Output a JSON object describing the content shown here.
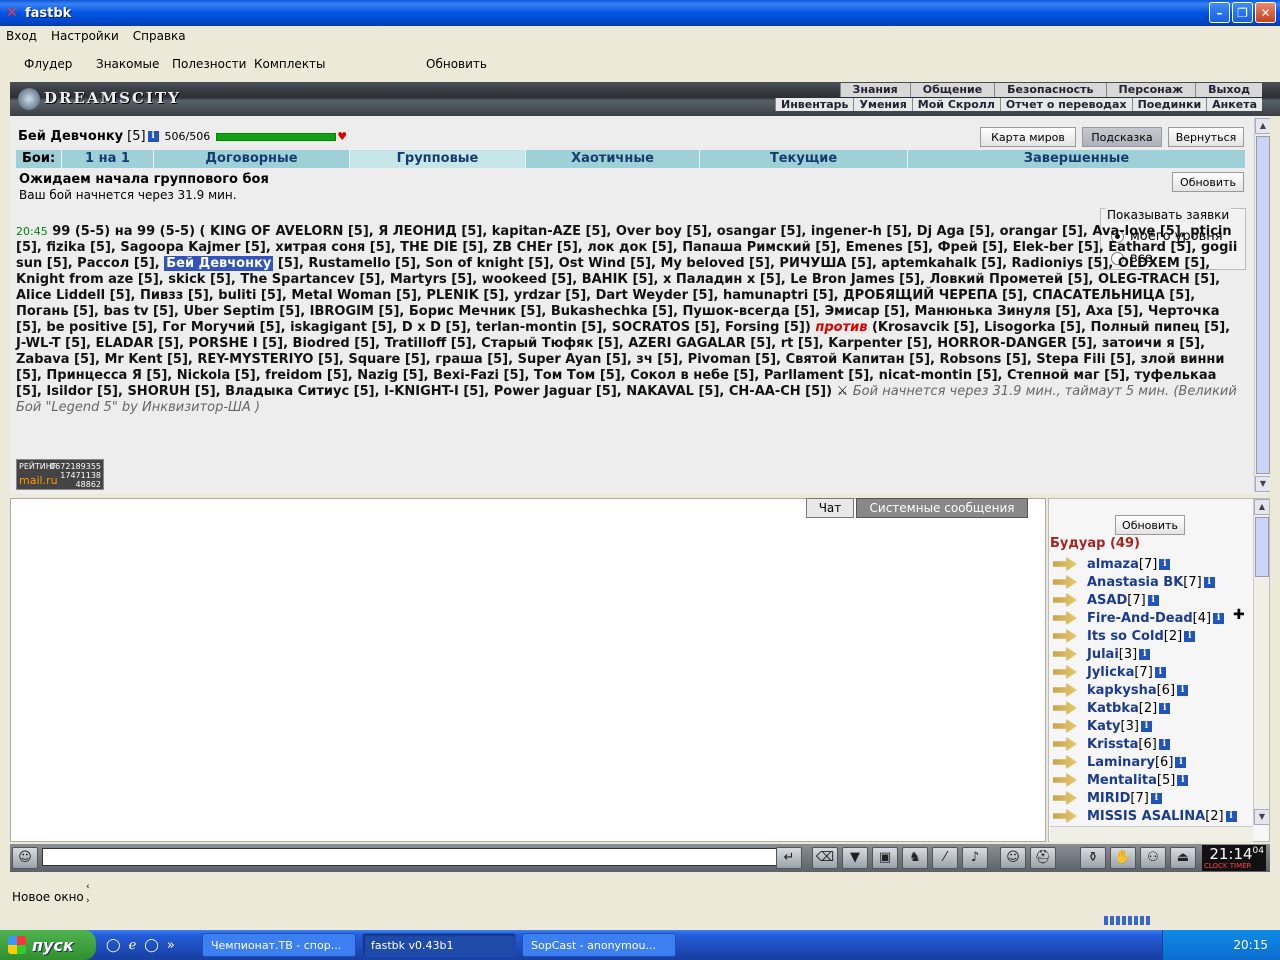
{
  "window": {
    "title": "fastbk"
  },
  "menu": [
    "Вход",
    "Настройки",
    "Справка"
  ],
  "toolbar": {
    "items": [
      "Флудер",
      "Знакомые",
      "Полезности",
      "Комплекты"
    ],
    "refresh": "Обновить"
  },
  "header": {
    "logo": "DREAMSCITY",
    "nav_top": [
      "Знания",
      "Общение",
      "Безопасность",
      "Персонаж",
      "Выход"
    ],
    "nav_bottom": [
      "Инвентарь",
      "Умения",
      "Мой Скролл",
      "Отчет о переводах",
      "Поединки",
      "Анкета"
    ]
  },
  "player": {
    "name": "Бей Девчонку",
    "level": "[5]",
    "hp": "506/506",
    "hp_fraction": 1.0
  },
  "buttons": {
    "world_map": "Карта миров",
    "hint": "Подсказка",
    "back": "Вернуться",
    "refresh": "Обновить"
  },
  "tabs": {
    "label": "Бои:",
    "items": [
      "1 на 1",
      "Договорные",
      "Групповые",
      "Хаотичные",
      "Текущие",
      "Завершенные"
    ],
    "active": "Групповые"
  },
  "status": {
    "title": "Ожидаем начала группового боя",
    "subtitle": "Ваш бой начнется через 31.9 мин."
  },
  "filter": {
    "legend": "Показывать заявки",
    "options": [
      "моего уровня",
      "все"
    ],
    "selected": "моего уровня"
  },
  "fight": {
    "time": "20:45",
    "header": "99 (5-5) на 99 (5-5) (",
    "team1_before_me": "KING OF AVELORN [5], Я ЛЕОНИД [5], kapitan-AZE [5], Over boy [5], osangar [5], ingener-h [5], Dj Aga [5], orangar [5], Ava-love [5], pticin [5], fizika [5], Sagoopa Kajmer [5], хитрая соня [5], THE DIE [5], ZB CHEr [5], лок док [5], Папаша Римский [5], Emenes [5], Фрей [5], Elek-ber [5], Eathard [5], gogii sun [5], Рассол [5],",
    "me": "Бей Девчонку",
    "team1_after_me": "[5], Rustamello [5], Son of knight [5], Ost Wind [5], My beloved [5], РИЧУША [5], aptemkahalk [5], Radioniys [5], OLDXEM [5], Knight from aze [5], skick [5], The Spartancev [5], Martyrs [5], wookeed [5], ВАНIК [5], x Паладин x [5], Le Bron James [5], Ловкий Прометей [5], OLEG-TRACH [5], Alice Liddell [5], Пивзз [5], buliti [5], Metal Woman [5], PLENIK [5], yrdzar [5], Dart Weyder [5], hamunaptri [5], ДРОБЯЩИЙ ЧЕРЕПА [5], СПАСАТЕЛЬНИЦА [5], Погань [5], bas tv [5], Uber Septim [5], IBROGIM [5], Борис Мечник [5], Bukashechka [5], Пушок-всегда [5], Эмисар [5], Манюнька Зинуля [5], Аха [5], Черточка [5], be positive [5], Гог Могучий [5], iskagigant [5], D x D [5], terlan-montin [5], SOCRATOS [5], Forsing [5])",
    "versus": "против",
    "team2": "(Krosavcik [5], Lisogorka [5], Полный пипец [5], J-WL-T [5], ELADAR [5], PORSHE I [5], Biodred [5], Tratilloff [5], Старый Тюфяк [5], AZERI GAGALAR [5], rt [5], Karpenter [5], HORROR-DANGER [5], затоичи я [5], Zabava [5], Mr Kent [5], REY-MYSTERIYO [5], Square [5], граша [5], Super Ayan [5], зч [5], Pivoman [5], Святой Капитан [5], Robsons [5], Stepa Fili [5], злой винни [5], Принцесса Я [5], Nickola [5], freidom [5], Nazig [5], Bexi-Fazi [5], Том Том [5], Сокол в небе [5], Parllament [5], nicat-montin [5], Степной маг [5], туфелькаа [5], Isildor [5], SHORUH [5], Владыка Ситиус [5], I-KNIGHT-I [5], Power Jaguar [5], NAKAVAL [5], CH-AA-CH [5])",
    "note": "Бой начнется через 31.9 мин., таймаут 5 мин. (Великий Бой \"Legend 5\" by Инквизитор-ША )"
  },
  "counter": {
    "label": "РЕЙТИНГ",
    "brand": "mail.ru",
    "values": [
      "0672189355",
      "17471138",
      "48862"
    ]
  },
  "chat": {
    "tabs": [
      "Чат",
      "Системные сообщения"
    ]
  },
  "users": {
    "refresh": "Обновить",
    "room": "Будуар (49)",
    "list": [
      {
        "name": "almaza",
        "level": "[7]"
      },
      {
        "name": "Anastasia BK",
        "level": "[7]"
      },
      {
        "name": "ASAD",
        "level": "[7]"
      },
      {
        "name": "Fire-And-Dead",
        "level": "[4]"
      },
      {
        "name": "Its so Cold",
        "level": "[2]"
      },
      {
        "name": "Julai",
        "level": "[3]"
      },
      {
        "name": "Jylicka",
        "level": "[7]"
      },
      {
        "name": "kapkysha",
        "level": "[6]"
      },
      {
        "name": "Katbka",
        "level": "[2]"
      },
      {
        "name": "Katy",
        "level": "[3]"
      },
      {
        "name": "Krissta",
        "level": "[6]"
      },
      {
        "name": "Laminary",
        "level": "[6]"
      },
      {
        "name": "Mentalita",
        "level": "[5]"
      },
      {
        "name": "MIRID",
        "level": "[7]"
      },
      {
        "name": "MISSIS ASALINA",
        "level": "[2]"
      }
    ]
  },
  "clock": {
    "time": "21:14",
    "seconds": "04",
    "label": "CLOCK TIMER"
  },
  "statusbar": {
    "new_window": "Новое окно"
  },
  "taskbar": {
    "start": "пуск",
    "tasks": [
      "Чемпионат.ТВ - спор...",
      "fastbk v0.43b1",
      "SopCast - anonymou..."
    ],
    "time": "20:15"
  }
}
